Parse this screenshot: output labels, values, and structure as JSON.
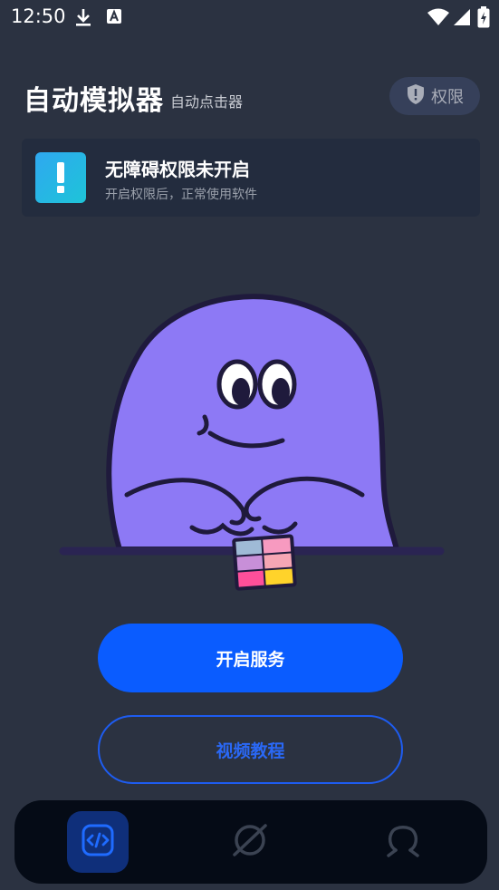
{
  "status_bar": {
    "time": "12:50",
    "icons": [
      "download-icon",
      "a-notification-icon",
      "wifi-icon",
      "signal-icon",
      "battery-charging-icon"
    ]
  },
  "header": {
    "title": "自动模拟器",
    "subtitle": "自动点击器",
    "permission_button": {
      "label": "权限",
      "icon": "shield-icon"
    }
  },
  "notice": {
    "icon": "exclamation-icon",
    "title": "无障碍权限未开启",
    "description": "开启权限后，正常使用软件"
  },
  "actions": {
    "primary_label": "开启服务",
    "secondary_label": "视频教程"
  },
  "bottom_nav": {
    "items": [
      {
        "icon": "code-icon",
        "active": true
      },
      {
        "icon": "planet-icon",
        "active": false
      },
      {
        "icon": "person-icon",
        "active": false
      }
    ]
  },
  "colors": {
    "background": "#2b3241",
    "primary": "#0a5cff",
    "card": "#232c3e",
    "nav": "#050b16",
    "mascot": "#8d79f5"
  }
}
